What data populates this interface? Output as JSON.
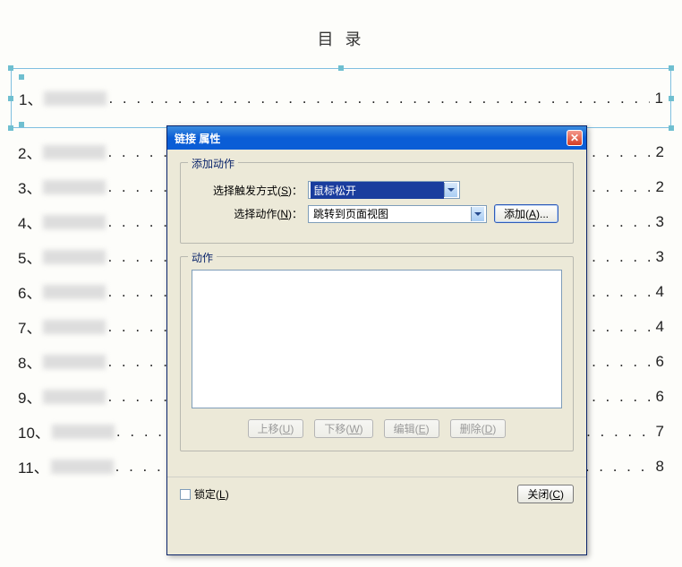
{
  "toc": {
    "title": "目 录",
    "items": [
      {
        "num": "1、",
        "page": "1"
      },
      {
        "num": "2、",
        "page": "2"
      },
      {
        "num": "3、",
        "page": "2"
      },
      {
        "num": "4、",
        "page": "3"
      },
      {
        "num": "5、",
        "page": "3"
      },
      {
        "num": "6、",
        "page": "4"
      },
      {
        "num": "7、",
        "page": "4"
      },
      {
        "num": "8、",
        "page": "6"
      },
      {
        "num": "9、",
        "page": "6"
      },
      {
        "num": "10、",
        "page": "7"
      },
      {
        "num": "11、",
        "page": "8"
      }
    ],
    "dots": ". . . . . . . . . . . . . . . . . . . . . . . . . . . . . . . . . . . . . . . . . . . . . . . . . . . . . . . . . . . . . . . . . . . . . . . . . . . . . . . . . . . . . . . . . . . . . . . . . . . . . . . ."
  },
  "dialog": {
    "title": "链接  属性",
    "group_add": {
      "legend": "添加动作",
      "trigger_label": "选择触发方式(S)：",
      "trigger_value": "鼠标松开",
      "action_label": "选择动作(N)：",
      "action_value": "跳转到页面视图",
      "add_btn": "添加(A)..."
    },
    "group_actions": {
      "legend": "动作",
      "btn_up": "上移(U)",
      "btn_down": "下移(W)",
      "btn_edit": "编辑(E)",
      "btn_delete": "删除(D)"
    },
    "footer": {
      "lock_label": "锁定(L)",
      "close_btn": "关闭(C)"
    }
  }
}
